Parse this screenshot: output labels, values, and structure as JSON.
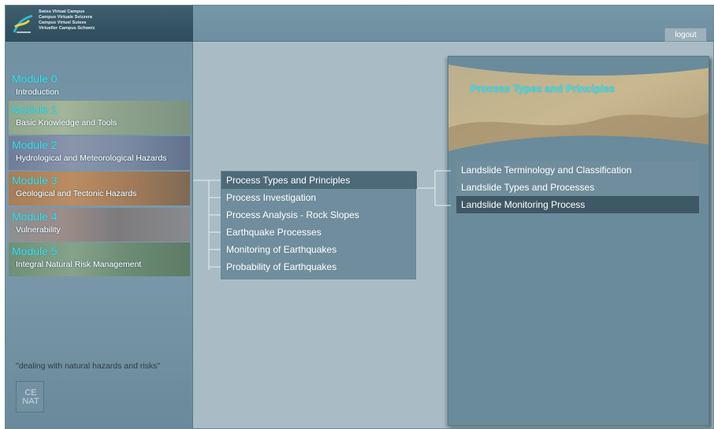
{
  "logo": {
    "lines": [
      "Swiss Virtual Campus",
      "Campus Virtuale Svizzera",
      "Campus Virtuel Suisse",
      "Virtueller Campus Schweiz"
    ]
  },
  "header": {
    "logout_label": "logout"
  },
  "modules": [
    {
      "title": "Module 0",
      "subtitle": "Introduction"
    },
    {
      "title": "Module 1",
      "subtitle": "Basic Knowledge and Tools"
    },
    {
      "title": "Module 2",
      "subtitle": "Hydrological and Meteorological Hazards"
    },
    {
      "title": "Module 3",
      "subtitle": "Geological and Tectonic Hazards"
    },
    {
      "title": "Module 4",
      "subtitle": "Vulnerability"
    },
    {
      "title": "Module 5",
      "subtitle": "Integral Natural Risk Management"
    }
  ],
  "tagline": "\"dealing with natural hazards and risks\"",
  "cenat_logo": "CE\nNAT",
  "mid_menu": {
    "active_index": 0,
    "items": [
      "Process Types and Principles",
      "Process Investigation",
      "Process Analysis - Rock Slopes",
      "Earthquake Processes",
      "Monitoring of Earthquakes",
      "Probability of Earthquakes"
    ]
  },
  "right_panel": {
    "title": "Process Types and Principles",
    "active_index": 2,
    "items": [
      "Landslide Terminology and Classification",
      "Landslide Types and Processes",
      "Landslide Monitoring Process"
    ]
  },
  "colors": {
    "accent_cyan": "#3de0ee",
    "panel_bg": "#6a8b9b",
    "active_row": "#3f5865"
  }
}
